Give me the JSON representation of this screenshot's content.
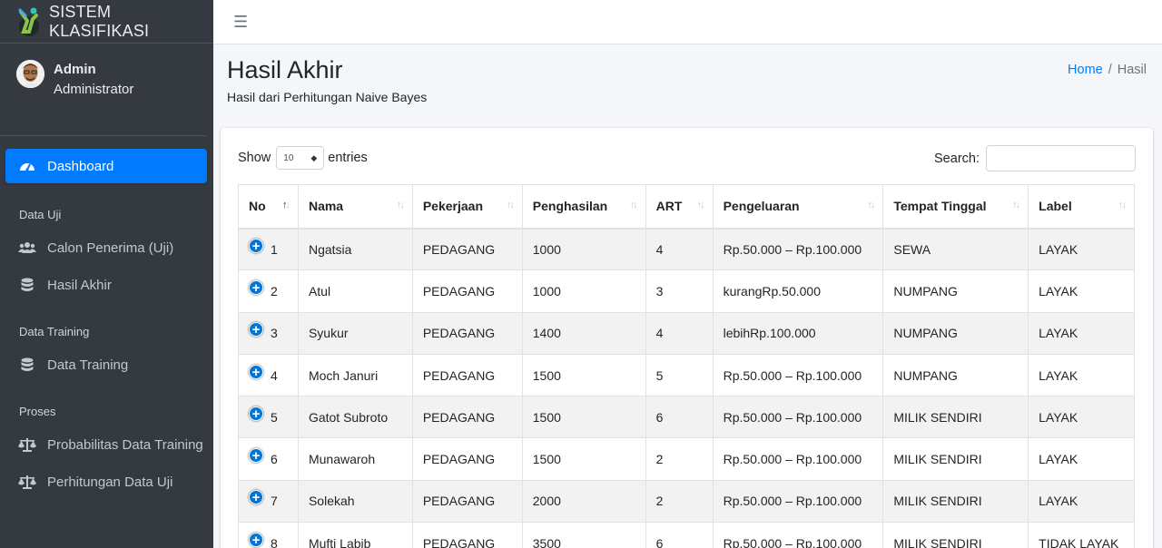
{
  "brand": {
    "title": "SISTEM KLASIFIKASI"
  },
  "user": {
    "name": "Admin",
    "role": "Administrator"
  },
  "sidebar": {
    "dashboard": "Dashboard",
    "sections": [
      {
        "header": "Data Uji",
        "items": [
          {
            "label": "Calon Penerima (Uji)",
            "icon": "users-icon"
          },
          {
            "label": "Hasil Akhir",
            "icon": "database-icon"
          }
        ]
      },
      {
        "header": "Data Training",
        "items": [
          {
            "label": "Data Training",
            "icon": "database-icon"
          }
        ]
      },
      {
        "header": "Proses",
        "items": [
          {
            "label": "Probabilitas Data Training",
            "icon": "balance-scale-icon"
          },
          {
            "label": "Perhitungan Data Uji",
            "icon": "balance-scale-icon"
          }
        ]
      }
    ],
    "active_color": "#007bff"
  },
  "topbar": {
    "menu_icon": "hamburger-icon"
  },
  "page": {
    "title": "Hasil Akhir",
    "subtitle": "Hasil dari Perhitungan Naive Bayes",
    "breadcrumb": {
      "home": "Home",
      "separator": "/",
      "current": "Hasil"
    }
  },
  "table_controls": {
    "show_label": "Show",
    "entries_value": "10",
    "entries_label": "entries",
    "search_label": "Search:",
    "search_value": ""
  },
  "table": {
    "columns": [
      "No",
      "Nama",
      "Pekerjaan",
      "Penghasilan",
      "ART",
      "Pengeluaran",
      "Tempat Tinggal",
      "Label"
    ],
    "rows": [
      [
        "1",
        "Ngatsia",
        "PEDAGANG",
        "1000",
        "4",
        "Rp.50.000 – Rp.100.000",
        "SEWA",
        "LAYAK"
      ],
      [
        "2",
        "Atul",
        "PEDAGANG",
        "1000",
        "3",
        "kurangRp.50.000",
        "NUMPANG",
        "LAYAK"
      ],
      [
        "3",
        "Syukur",
        "PEDAGANG",
        "1400",
        "4",
        "lebihRp.100.000",
        "NUMPANG",
        "LAYAK"
      ],
      [
        "4",
        "Moch Januri",
        "PEDAGANG",
        "1500",
        "5",
        "Rp.50.000 – Rp.100.000",
        "NUMPANG",
        "LAYAK"
      ],
      [
        "5",
        "Gatot Subroto",
        "PEDAGANG",
        "1500",
        "6",
        "Rp.50.000 – Rp.100.000",
        "MILIK SENDIRI",
        "LAYAK"
      ],
      [
        "6",
        "Munawaroh",
        "PEDAGANG",
        "1500",
        "2",
        "Rp.50.000 – Rp.100.000",
        "MILIK SENDIRI",
        "LAYAK"
      ],
      [
        "7",
        "Solekah",
        "PEDAGANG",
        "2000",
        "2",
        "Rp.50.000 – Rp.100.000",
        "MILIK SENDIRI",
        "LAYAK"
      ],
      [
        "8",
        "Mufti Labib",
        "PEDAGANG",
        "3500",
        "6",
        "Rp.50.000 – Rp.100.000",
        "MILIK SENDIRI",
        "TIDAK LAYAK"
      ]
    ]
  }
}
